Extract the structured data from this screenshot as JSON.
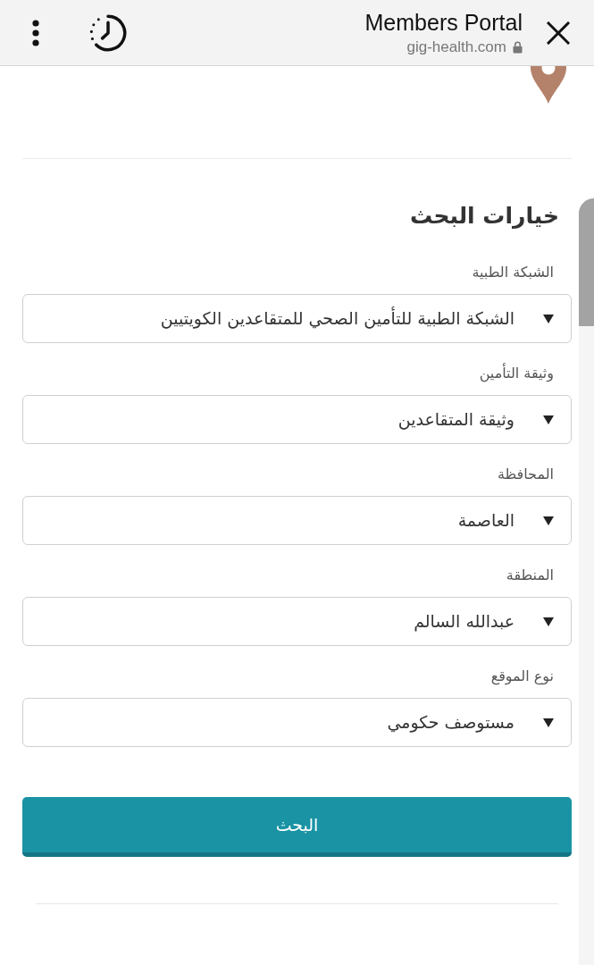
{
  "browser_bar": {
    "title": "Members Portal",
    "url": "gig-health.com",
    "secure": true
  },
  "search_options": {
    "heading": "خيارات البحث",
    "fields": [
      {
        "label": "الشبكة الطبية",
        "value": "الشبكة الطبية للتأمين الصحي للمتقاعدين الكويتيين"
      },
      {
        "label": "وثيقة التأمين",
        "value": "وثيقة المتقاعدين"
      },
      {
        "label": "المحافظة",
        "value": "العاصمة"
      },
      {
        "label": "المنطقة",
        "value": "عبدالله السالم"
      },
      {
        "label": "نوع الموقع",
        "value": "مستوصف حكومي"
      }
    ],
    "submit": "البحث"
  }
}
